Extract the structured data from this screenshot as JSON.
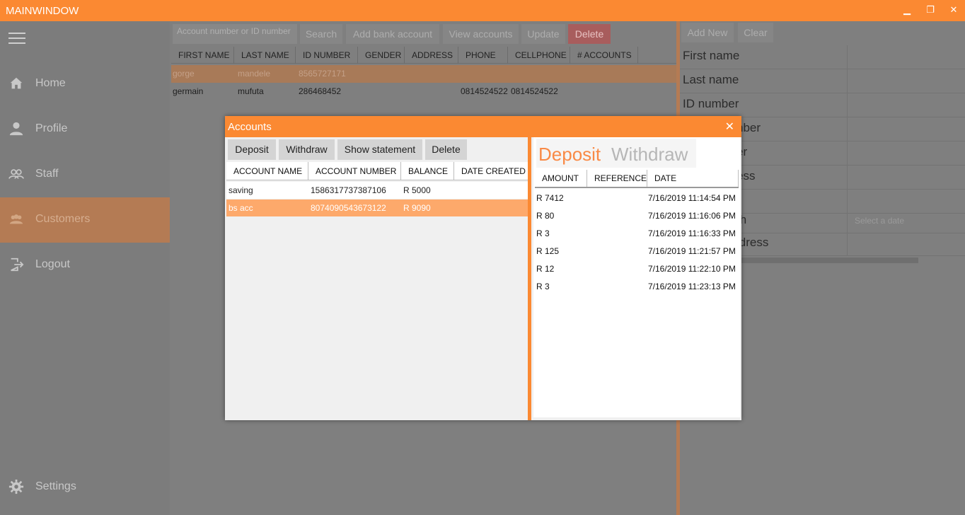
{
  "window": {
    "title": "MAINWINDOW",
    "minimize_glyph": "▁",
    "maximize_glyph": "❐",
    "close_glyph": "✕"
  },
  "sidebar": {
    "items": [
      {
        "label": "Home",
        "icon": "home-icon"
      },
      {
        "label": "Profile",
        "icon": "person-icon"
      },
      {
        "label": "Staff",
        "icon": "group-icon"
      },
      {
        "label": "Customers",
        "icon": "people-icon",
        "active": true
      },
      {
        "label": "Logout",
        "icon": "logout-icon"
      }
    ],
    "settings_label": "Settings"
  },
  "toolbar": {
    "search_placeholder": "Account number or ID number",
    "search_label": "Search",
    "add_bank_account_label": "Add bank account",
    "view_accounts_label": "View accounts",
    "update_label": "Update",
    "delete_label": "Delete"
  },
  "customers_table": {
    "columns": [
      "FIRST NAME",
      "LAST NAME",
      "ID NUMBER",
      "GENDER",
      "ADDRESS",
      "PHONE",
      "CELLPHONE",
      "# ACCOUNTS"
    ],
    "rows": [
      {
        "first": "gorge",
        "last": "mandele",
        "id": "8565727171",
        "gender": "",
        "address": "",
        "phone": "",
        "cell": "",
        "accounts": ""
      },
      {
        "first": "germain",
        "last": "mufuta",
        "id": "286468452",
        "gender": "",
        "address": "",
        "phone": "0814524522",
        "cell": "0814524522",
        "accounts": ""
      }
    ]
  },
  "form": {
    "add_new_label": "Add New",
    "clear_label": "Clear",
    "fields": [
      {
        "label": "First name"
      },
      {
        "label": "Last name"
      },
      {
        "label": "ID number"
      },
      {
        "label": "nber"
      },
      {
        "label": "er"
      },
      {
        "label": "ess"
      },
      {
        "label": ""
      },
      {
        "label": "th",
        "placeholder": "Select a date"
      },
      {
        "label": "ldress"
      }
    ]
  },
  "dialog": {
    "title": "Accounts",
    "close_glyph": "✕",
    "buttons": {
      "deposit": "Deposit",
      "withdraw": "Withdraw",
      "show_statement": "Show statement",
      "delete": "Delete"
    },
    "accounts_columns": [
      "ACCOUNT NAME",
      "ACCOUNT NUMBER",
      "BALANCE",
      "DATE CREATED"
    ],
    "accounts": [
      {
        "name": "saving",
        "number": "1586317737387106",
        "balance": "R 5000",
        "created": ""
      },
      {
        "name": "bs acc",
        "number": "8074090543673122",
        "balance": "R 9090",
        "created": ""
      }
    ],
    "tabs": {
      "deposit": "Deposit",
      "withdraw": "Withdraw"
    },
    "tx_columns": [
      "AMOUNT",
      "REFERENCE",
      "DATE"
    ],
    "transactions": [
      {
        "amount": "R 7412",
        "reference": "",
        "date": "7/16/2019 11:14:54 PM"
      },
      {
        "amount": "R 80",
        "reference": "",
        "date": "7/16/2019 11:16:06 PM"
      },
      {
        "amount": "R 3",
        "reference": "",
        "date": "7/16/2019 11:16:33 PM"
      },
      {
        "amount": "R 125",
        "reference": "",
        "date": "7/16/2019 11:21:57 PM"
      },
      {
        "amount": "R 12",
        "reference": "",
        "date": "7/16/2019 11:22:10 PM"
      },
      {
        "amount": "R 3",
        "reference": "",
        "date": "7/16/2019 11:23:13 PM"
      }
    ]
  },
  "colors": {
    "accent": "#fb8932",
    "selected_row": "#fda96b",
    "delete_button": "#a85d5d",
    "overlay_gray": "#7f7f7f"
  }
}
